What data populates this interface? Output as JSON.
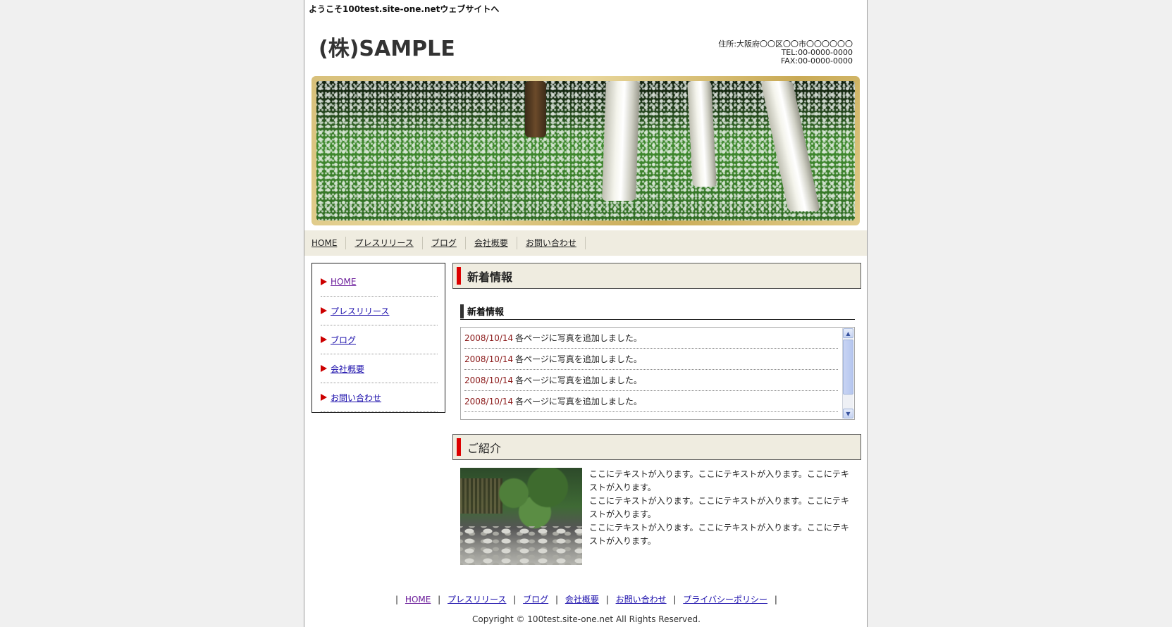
{
  "header": {
    "welcome": "ようこそ100test.site-one.netウェブサイトへ",
    "company_name": "(株)SAMPLE",
    "address": "住所:大阪府〇〇区〇〇市〇〇〇〇〇〇",
    "tel": "TEL:00-0000-0000",
    "fax": "FAX:00-0000-0000"
  },
  "nav": {
    "items": [
      "HOME",
      "プレスリリース",
      "ブログ",
      "会社概要",
      "お問い合わせ"
    ]
  },
  "sidebar": {
    "items": [
      "HOME",
      "プレスリリース",
      "ブログ",
      "会社概要",
      "お問い合わせ"
    ]
  },
  "news": {
    "section_title": "新着情報",
    "sub_title": "新着情報",
    "rows": [
      {
        "date": "2008/10/14",
        "text": "各ページに写真を追加しました。"
      },
      {
        "date": "2008/10/14",
        "text": "各ページに写真を追加しました。"
      },
      {
        "date": "2008/10/14",
        "text": "各ページに写真を追加しました。"
      },
      {
        "date": "2008/10/14",
        "text": "各ページに写真を追加しました。"
      }
    ]
  },
  "intro": {
    "section_title": "ご紹介",
    "paragraphs": [
      "ここにテキストが入ります。ここにテキストが入ります。ここにテキストが入ります。",
      "ここにテキストが入ります。ここにテキストが入ります。ここにテキストが入ります。",
      "ここにテキストが入ります。ここにテキストが入ります。ここにテキストが入ります。"
    ]
  },
  "footer": {
    "links": [
      "HOME",
      "プレスリリース",
      "ブログ",
      "会社概要",
      "お問い合わせ",
      "プライバシーポリシー"
    ],
    "separator": "|",
    "copyright": "Copyright © 100test.site-one.net All Rights Reserved."
  },
  "colors": {
    "accent_red": "#dd0000",
    "nav_bg": "#efece0",
    "link": "#1a0dab",
    "date": "#8b1a1a"
  },
  "icons": {
    "sidebar_bullet": "triangle-right-icon",
    "scroll_up": "chevron-up-icon",
    "scroll_down": "chevron-down-icon"
  }
}
